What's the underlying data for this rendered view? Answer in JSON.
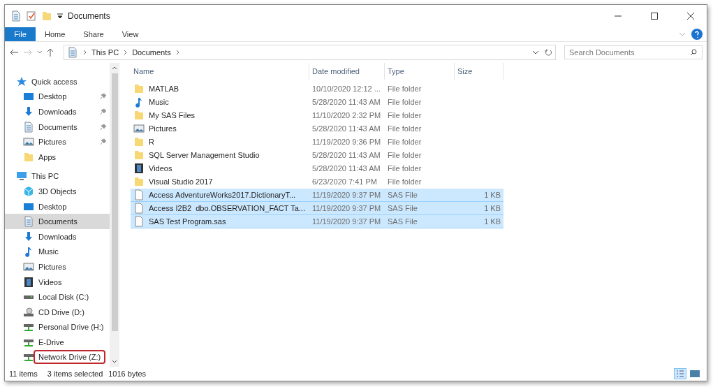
{
  "window": {
    "title": "Documents"
  },
  "ribbon_tabs": [
    {
      "label": "File",
      "selected": true
    },
    {
      "label": "Home",
      "selected": false
    },
    {
      "label": "Share",
      "selected": false
    },
    {
      "label": "View",
      "selected": false
    }
  ],
  "address": {
    "path": [
      "This PC",
      "Documents"
    ]
  },
  "search": {
    "placeholder": "Search Documents"
  },
  "sidebar": {
    "items": [
      {
        "label": "Quick access",
        "kind": "star",
        "selected": false,
        "highlighted": false,
        "children": [
          {
            "label": "Desktop",
            "kind": "desktop",
            "pinned": true,
            "selected": false,
            "highlighted": false
          },
          {
            "label": "Downloads",
            "kind": "download",
            "pinned": true,
            "selected": false,
            "highlighted": false
          },
          {
            "label": "Documents",
            "kind": "document",
            "pinned": true,
            "selected": false,
            "highlighted": false
          },
          {
            "label": "Pictures",
            "kind": "pictures",
            "pinned": true,
            "selected": false,
            "highlighted": false
          },
          {
            "label": "Apps",
            "kind": "folder",
            "pinned": false,
            "selected": false,
            "highlighted": false
          }
        ]
      },
      {
        "label": "This PC",
        "kind": "pc",
        "selected": false,
        "highlighted": false,
        "children": [
          {
            "label": "3D Objects",
            "kind": "cube",
            "selected": false,
            "highlighted": false
          },
          {
            "label": "Desktop",
            "kind": "desktop",
            "selected": false,
            "highlighted": false
          },
          {
            "label": "Documents",
            "kind": "document",
            "selected": true,
            "highlighted": false
          },
          {
            "label": "Downloads",
            "kind": "download",
            "selected": false,
            "highlighted": false
          },
          {
            "label": "Music",
            "kind": "music",
            "selected": false,
            "highlighted": false
          },
          {
            "label": "Pictures",
            "kind": "pictures",
            "selected": false,
            "highlighted": false
          },
          {
            "label": "Videos",
            "kind": "videos",
            "selected": false,
            "highlighted": false
          },
          {
            "label": "Local Disk (C:)",
            "kind": "disk",
            "selected": false,
            "highlighted": false
          },
          {
            "label": "CD Drive (D:)",
            "kind": "cd",
            "selected": false,
            "highlighted": false
          },
          {
            "label": "Personal Drive (H:)",
            "kind": "netdrive",
            "selected": false,
            "highlighted": false
          },
          {
            "label": "E-Drive",
            "kind": "netdrive",
            "selected": false,
            "highlighted": false
          },
          {
            "label": "Network Drive (Z:)",
            "kind": "netdrive",
            "selected": false,
            "highlighted": true
          }
        ]
      }
    ]
  },
  "table": {
    "columns": [
      "Name",
      "Date modified",
      "Type",
      "Size"
    ],
    "rows": [
      {
        "kind": "folder",
        "name": "MATLAB",
        "date": "10/10/2020 12:12 ...",
        "type": "File folder",
        "size": "",
        "selected": false
      },
      {
        "kind": "music",
        "name": "Music",
        "date": "5/28/2020 11:43 AM",
        "type": "File folder",
        "selected": false
      },
      {
        "kind": "folder",
        "name": "My SAS Files",
        "date": "11/10/2020 2:32 PM",
        "type": "File folder",
        "selected": false
      },
      {
        "kind": "pictures",
        "name": "Pictures",
        "date": "5/28/2020 11:43 AM",
        "type": "File folder",
        "selected": false
      },
      {
        "kind": "folder",
        "name": "R",
        "date": "11/19/2020 9:36 PM",
        "type": "File folder",
        "selected": false
      },
      {
        "kind": "folder",
        "name": "SQL Server Management Studio",
        "date": "5/28/2020 11:43 AM",
        "type": "File folder",
        "selected": false
      },
      {
        "kind": "videos",
        "name": "Videos",
        "date": "5/28/2020 11:43 AM",
        "type": "File folder",
        "selected": false
      },
      {
        "kind": "folder",
        "name": "Visual Studio 2017",
        "date": "6/23/2020 7:41 PM",
        "type": "File folder",
        "selected": false
      },
      {
        "kind": "file",
        "name": "Access AdventureWorks2017.DictionaryT...",
        "date": "11/19/2020 9:37 PM",
        "type": "SAS File",
        "size": "1 KB",
        "selected": true
      },
      {
        "kind": "file",
        "name": "Access I2B2  dbo.OBSERVATION_FACT Ta...",
        "date": "11/19/2020 9:37 PM",
        "type": "SAS File",
        "size": "1 KB",
        "selected": true
      },
      {
        "kind": "file",
        "name": "SAS Test Program.sas",
        "date": "11/19/2020 9:37 PM",
        "type": "SAS File",
        "size": "1 KB",
        "selected": true
      }
    ]
  },
  "status_bar": {
    "count": "11 items",
    "selection": "3 items selected",
    "size": "1016 bytes"
  }
}
